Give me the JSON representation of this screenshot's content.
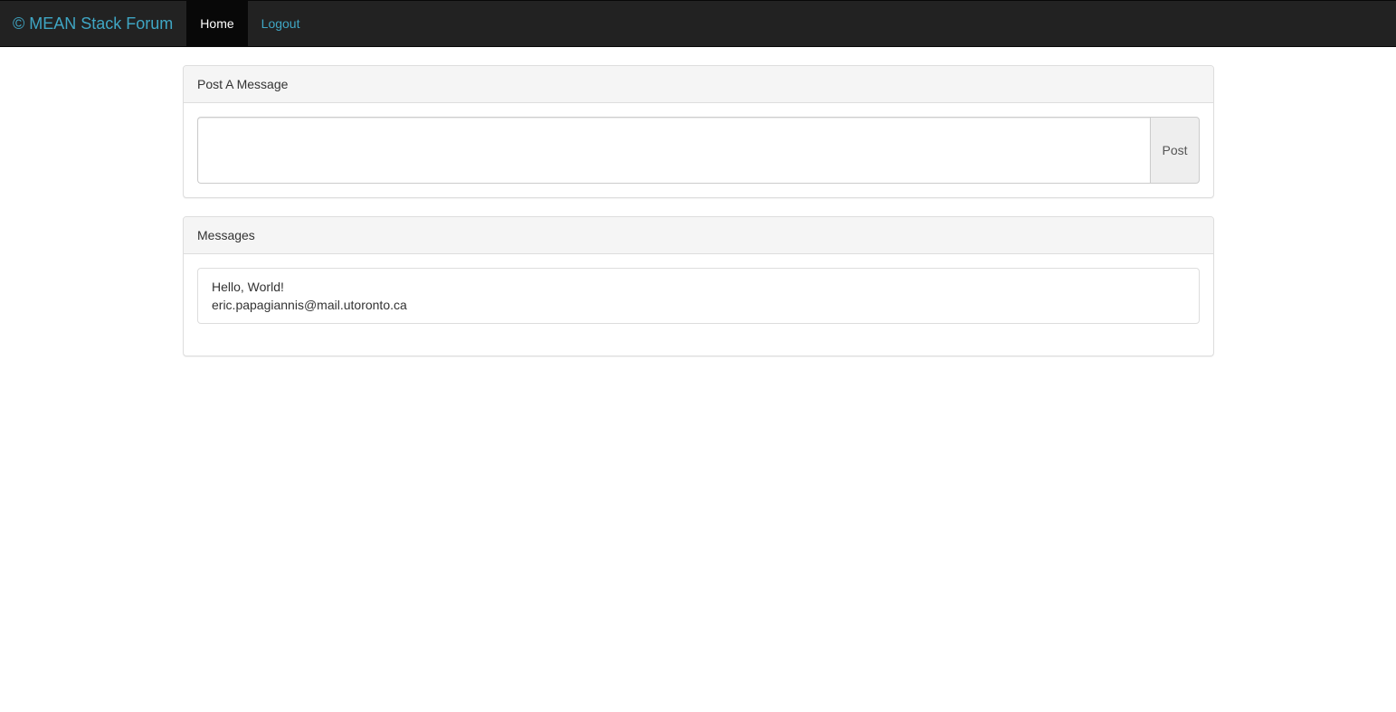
{
  "navbar": {
    "brand": "© MEAN Stack Forum",
    "items": [
      {
        "label": "Home",
        "active": true
      },
      {
        "label": "Logout",
        "active": false
      }
    ]
  },
  "post_panel": {
    "heading": "Post A Message",
    "input_value": "",
    "button_label": "Post"
  },
  "messages_panel": {
    "heading": "Messages",
    "messages": [
      {
        "text": "Hello, World!",
        "author": "eric.papagiannis@mail.utoronto.ca"
      }
    ]
  },
  "colors": {
    "navbar_bg": "#222222",
    "link": "#3fa6c4",
    "active_bg": "#080808"
  }
}
